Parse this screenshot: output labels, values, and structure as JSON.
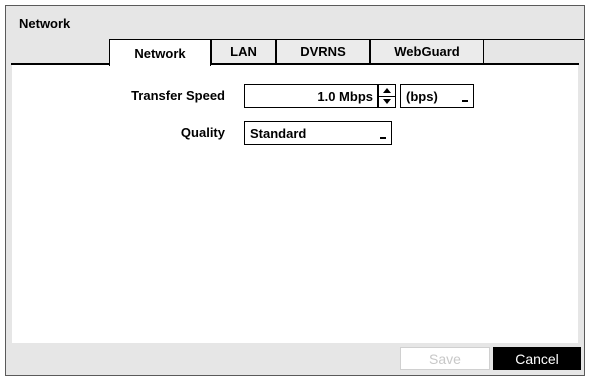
{
  "window": {
    "title": "Network"
  },
  "tabs": [
    {
      "label": "Network",
      "active": true
    },
    {
      "label": "LAN",
      "active": false
    },
    {
      "label": "DVRNS",
      "active": false
    },
    {
      "label": "WebGuard",
      "active": false
    }
  ],
  "form": {
    "transfer_speed": {
      "label": "Transfer Speed",
      "value": "1.0 Mbps",
      "units": "(bps)"
    },
    "quality": {
      "label": "Quality",
      "value": "Standard"
    }
  },
  "buttons": {
    "save": "Save",
    "cancel": "Cancel"
  },
  "icons": {
    "spin_up": "triangle-up-icon",
    "spin_down": "triangle-down-icon",
    "dropdown": "dropdown-caret-icon"
  },
  "colors": {
    "dialog_bg": "#e6e6e6",
    "panel_bg": "#ffffff",
    "cancel_bg": "#000000",
    "save_disabled_text": "#c8c8c8"
  }
}
